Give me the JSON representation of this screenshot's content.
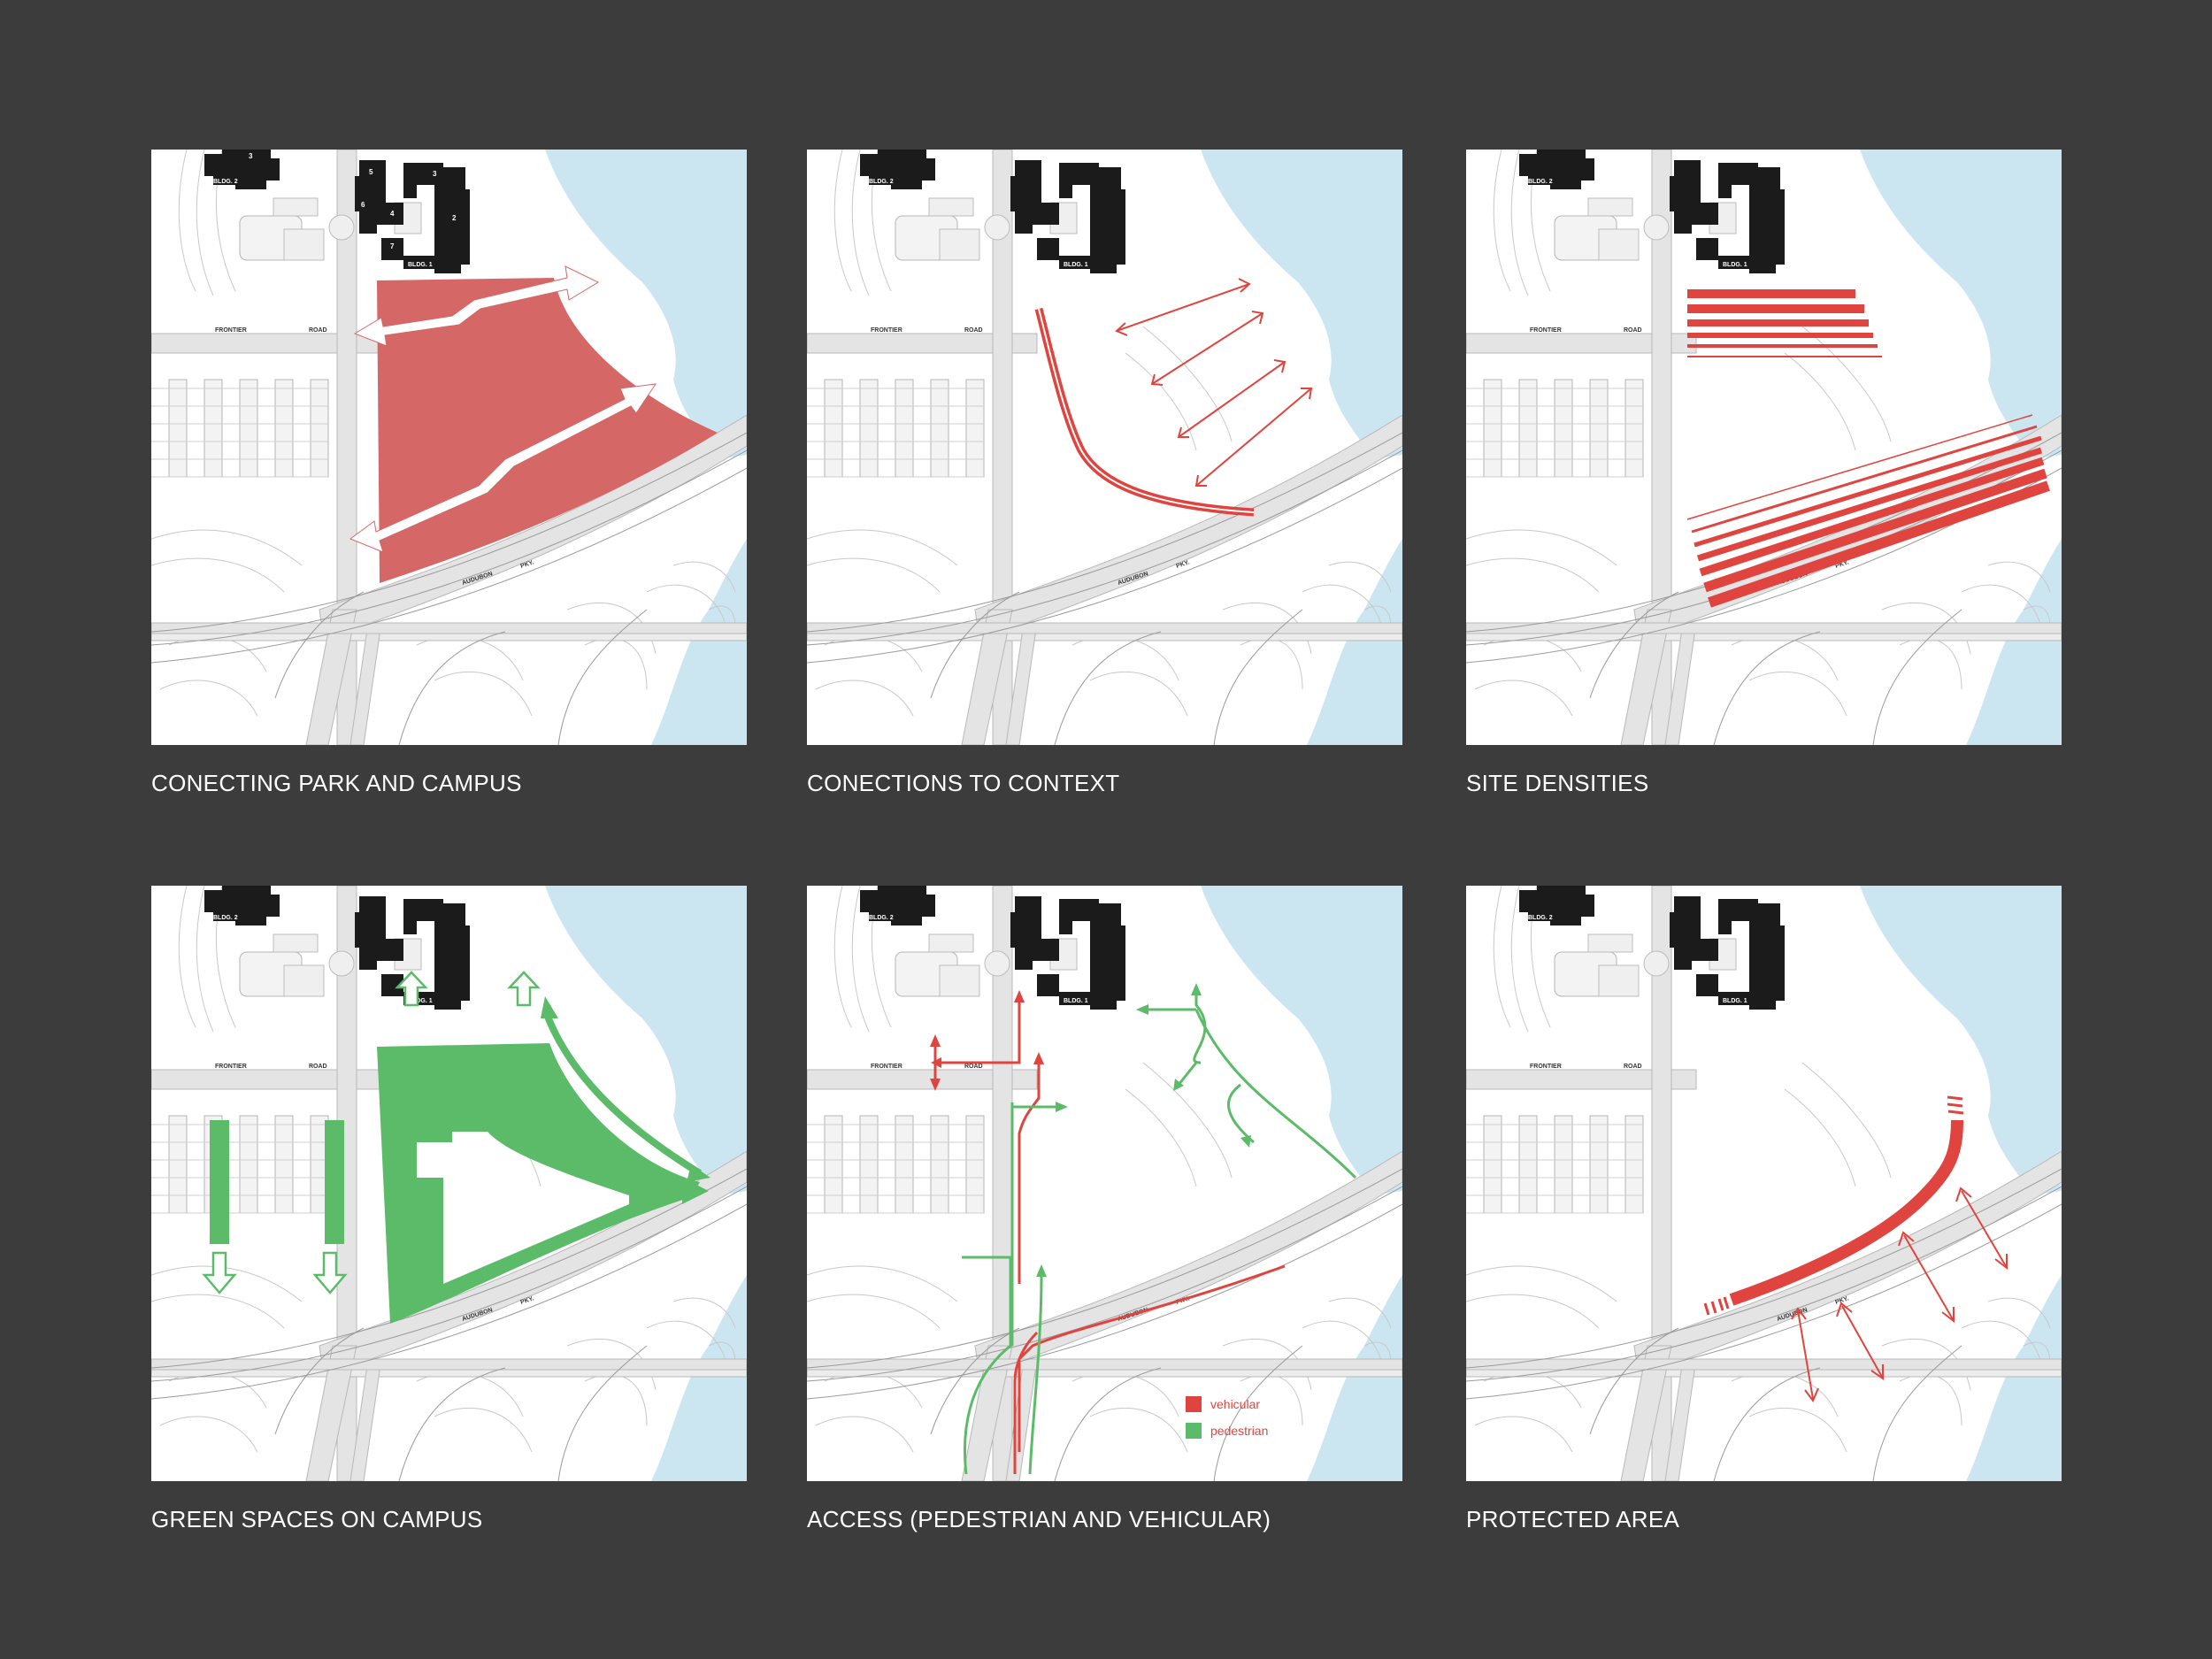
{
  "colors": {
    "background": "#3c3c3c",
    "water": "#cce6f1",
    "red": "#e0443f",
    "red_fill": "#d56767",
    "green": "#5cbb69",
    "building": "#1b1b1b"
  },
  "map_labels": {
    "bldg1": "BLDG. 1",
    "bldg2": "BLDG. 2",
    "frontier": "FRONTIER",
    "road": "ROAD",
    "audubon": "AUDUBON",
    "pky": "PKY.",
    "n1": "1",
    "n2": "2",
    "n3": "3",
    "n4": "4",
    "n5": "5",
    "n6": "6",
    "n7": "7"
  },
  "panels": [
    {
      "caption": "CONECTING PARK AND CAMPUS"
    },
    {
      "caption": "CONECTIONS TO CONTEXT"
    },
    {
      "caption": "SITE DENSITIES"
    },
    {
      "caption": "GREEN SPACES ON CAMPUS"
    },
    {
      "caption": "ACCESS (PEDESTRIAN AND VEHICULAR)",
      "legend": {
        "vehicular": "vehicular",
        "pedestrian": "pedestrian"
      }
    },
    {
      "caption": "PROTECTED AREA"
    }
  ]
}
